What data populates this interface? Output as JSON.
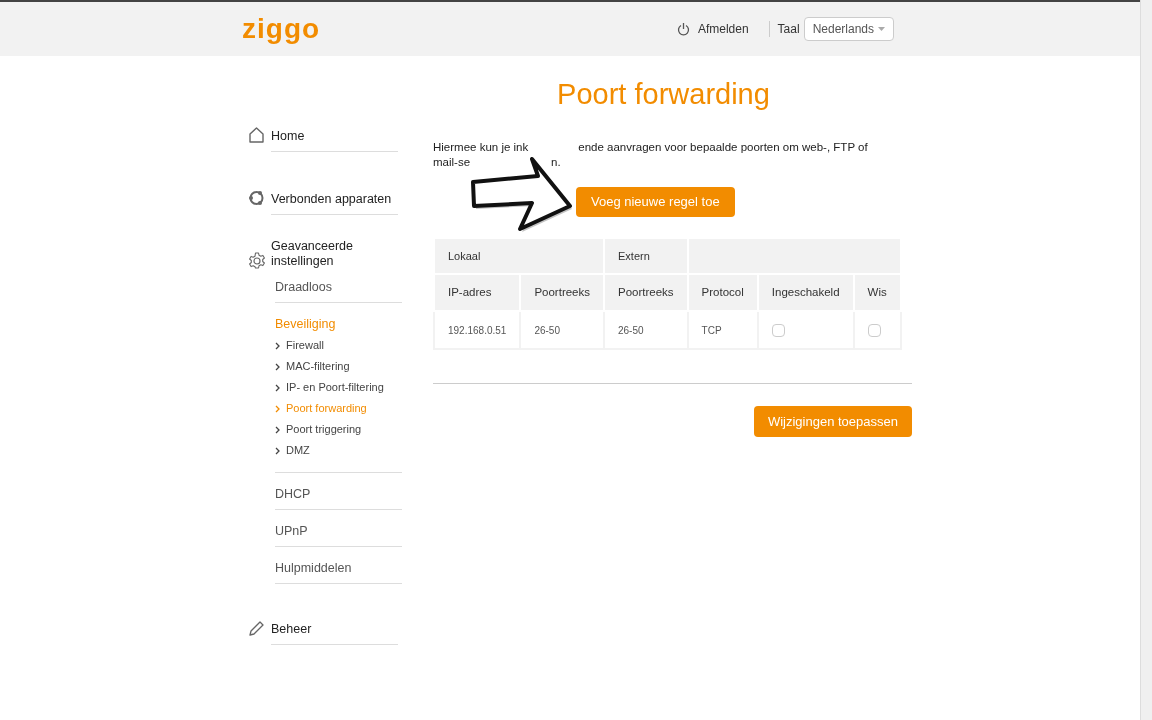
{
  "header": {
    "logo": "ziggo",
    "logout": "Afmelden",
    "language_label": "Taal",
    "language_value": "Nederlands"
  },
  "sidebar": {
    "items": [
      {
        "label": "Home",
        "selected": false
      },
      {
        "label": "Verbonden apparaten",
        "selected": false
      },
      {
        "label": "Geavanceerde instellingen",
        "selected": false,
        "children": [
          {
            "label": "Draadloos",
            "selected": false
          },
          {
            "label": "Beveiliging",
            "selected": true,
            "children": [
              {
                "label": "Firewall",
                "selected": false
              },
              {
                "label": "MAC-filtering",
                "selected": false
              },
              {
                "label": "IP- en Poort-filtering",
                "selected": false
              },
              {
                "label": "Poort forwarding",
                "selected": true
              },
              {
                "label": "Poort triggering",
                "selected": false
              },
              {
                "label": "DMZ",
                "selected": false
              }
            ]
          },
          {
            "label": "DHCP",
            "selected": false
          },
          {
            "label": "UPnP",
            "selected": false
          },
          {
            "label": "Hulpmiddelen",
            "selected": false
          }
        ]
      },
      {
        "label": "Beheer",
        "selected": false
      }
    ]
  },
  "page_title": "Poort forwarding",
  "description_lines": [
    [
      "Hiermee kun je ink",
      "ende aanvragen voor bepaalde poorten om web-, FTP of"
    ],
    [
      "mail-se",
      "n."
    ]
  ],
  "add_button": "Voeg nieuwe regel toe",
  "table": {
    "groups": [
      "Lokaal",
      "Extern"
    ],
    "columns": [
      "IP-adres",
      "Poortreeks",
      "Poortreeks",
      "Protocol",
      "Ingeschakeld",
      "Wis"
    ],
    "rows": [
      {
        "ip": "192.168.0.51",
        "local_range": "26-50",
        "external_range": "26-50",
        "protocol": "TCP",
        "enabled": false,
        "delete": false
      }
    ]
  },
  "apply_button": "Wijzigingen toepassen"
}
